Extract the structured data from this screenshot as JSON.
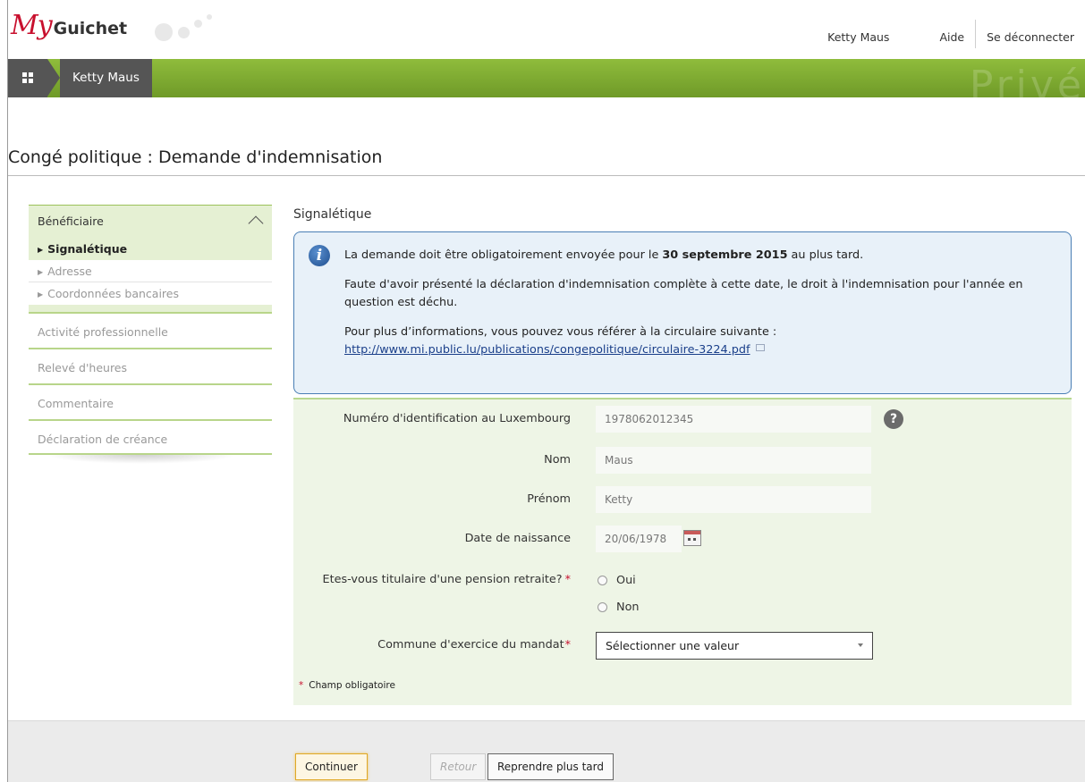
{
  "header": {
    "logo_my": "My",
    "logo_guichet": "Guichet",
    "user_name": "Ketty Maus",
    "help_label": "Aide",
    "logout_label": "Se déconnecter"
  },
  "nav": {
    "breadcrumb": "Ketty Maus",
    "space_label": "Privé"
  },
  "page": {
    "title": "Congé politique : Demande d'indemnisation"
  },
  "sidebar": {
    "group_title": "Bénéficiaire",
    "sub_items": [
      {
        "label": "Signalétique"
      },
      {
        "label": "Adresse"
      },
      {
        "label": "Coordonnées bancaires"
      }
    ],
    "items": [
      {
        "label": "Activité professionnelle"
      },
      {
        "label": "Relevé d'heures"
      },
      {
        "label": "Commentaire"
      },
      {
        "label": "Déclaration de créance"
      }
    ]
  },
  "section": {
    "title": "Signalétique"
  },
  "info": {
    "line1_prefix": "La demande doit être obligatoirement envoyée pour le ",
    "line1_date": "30 septembre 2015",
    "line1_suffix": " au plus tard.",
    "line2": "Faute d'avoir présenté la déclaration d'indemnisation complète à cette date, le droit à l'indemnisation pour l'année en question est déchu.",
    "line3_prefix": "Pour plus d’informations, vous pouvez vous référer à la circulaire suivante : ",
    "link_text": "http://www.mi.public.lu/publications/congepolitique/circulaire-3224.pdf"
  },
  "form": {
    "id_label": "Numéro d'identification au Luxembourg",
    "id_value": "1978062012345",
    "nom_label": "Nom",
    "nom_value": "Maus",
    "prenom_label": "Prénom",
    "prenom_value": "Ketty",
    "dob_label": "Date de naissance",
    "dob_value": "20/06/1978",
    "pension_label": "Etes-vous titulaire d'une pension retraite?",
    "pension_options": [
      {
        "label": "Oui"
      },
      {
        "label": "Non"
      }
    ],
    "commune_label": "Commune d'exercice du mandat",
    "commune_value": "Sélectionner une valeur",
    "required_marker": "*",
    "required_note": "Champ obligatoire",
    "help_symbol": "?"
  },
  "actions": {
    "continue_label": "Continuer",
    "back_label": "Retour",
    "later_label": "Reprendre plus tard"
  },
  "colors": {
    "brand_red": "#c8102e",
    "nav_green": "#7fab33",
    "info_border": "#4a7fb5"
  }
}
